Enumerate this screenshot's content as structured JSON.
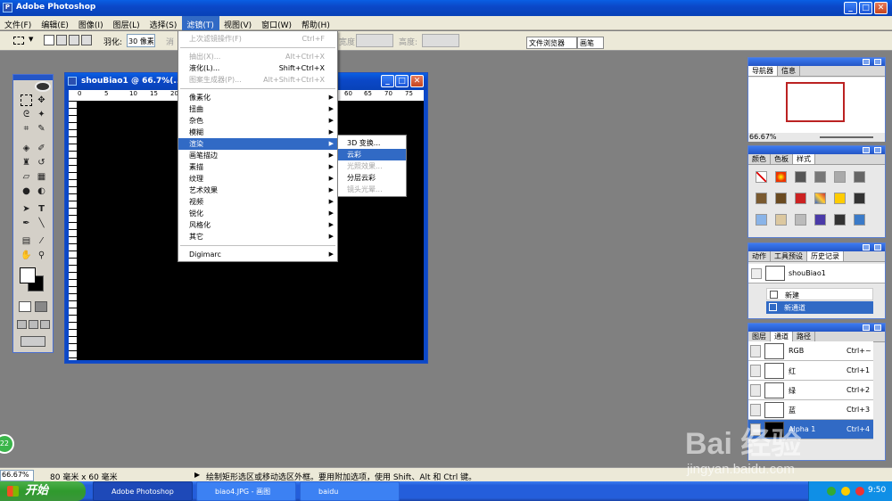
{
  "app": {
    "title": "Adobe Photoshop"
  },
  "menubar": [
    "文件(F)",
    "编辑(E)",
    "图像(I)",
    "图层(L)",
    "选择(S)",
    "滤镜(T)",
    "视图(V)",
    "窗口(W)",
    "帮助(H)"
  ],
  "options": {
    "feather_label": "羽化:",
    "feather_value": "30 像素",
    "anti_alias": "消",
    "width_label": "宽度:",
    "height_label": "高度:",
    "file_browser": "文件浏览器",
    "brushes": "画笔"
  },
  "filter_menu": {
    "last_filter": {
      "label": "上次滤镜操作(F)",
      "shortcut": "Ctrl+F"
    },
    "extract": {
      "label": "抽出(X)...",
      "shortcut": "Alt+Ctrl+X"
    },
    "liquify": {
      "label": "液化(L)...",
      "shortcut": "Shift+Ctrl+X"
    },
    "pattern": {
      "label": "图案生成器(P)...",
      "shortcut": "Alt+Shift+Ctrl+X"
    },
    "items": [
      "像素化",
      "扭曲",
      "杂色",
      "模糊",
      "渲染",
      "画笔描边",
      "素描",
      "纹理",
      "艺术效果",
      "视频",
      "锐化",
      "风格化",
      "其它"
    ],
    "digimarc": "Digimarc"
  },
  "render_submenu": [
    "3D 变换...",
    "云彩",
    "光照效果...",
    "分层云彩",
    "镜头光晕..."
  ],
  "document": {
    "title": "shouBiao1 @ 66.7%(...",
    "ruler_marks": [
      "0",
      "5",
      "10",
      "15",
      "20",
      "60",
      "65",
      "70",
      "75"
    ]
  },
  "navigator": {
    "tabs": [
      "导航器",
      "信息"
    ],
    "zoom": "66.67%"
  },
  "color_panel": {
    "tabs": [
      "颜色",
      "色板",
      "样式"
    ]
  },
  "history_panel": {
    "tabs": [
      "动作",
      "工具预设",
      "历史记录"
    ],
    "snapshot": "shouBiao1",
    "steps": [
      "新建",
      "新通道"
    ]
  },
  "channels_panel": {
    "tabs": [
      "图层",
      "通道",
      "路径"
    ],
    "channels": [
      {
        "name": "RGB",
        "key": "Ctrl+~"
      },
      {
        "name": "红",
        "key": "Ctrl+1"
      },
      {
        "name": "绿",
        "key": "Ctrl+2"
      },
      {
        "name": "蓝",
        "key": "Ctrl+3"
      },
      {
        "name": "Alpha 1",
        "key": "Ctrl+4"
      }
    ]
  },
  "status": {
    "zoom": "66.67%",
    "doc_size": "80 毫米 x 60 毫米",
    "hint": "绘制矩形选区或移动选区外框。要用附加选项，使用 Shift、Alt 和 Ctrl 键。"
  },
  "taskbar": {
    "start": "开始",
    "items": [
      "Adobe Photoshop",
      "biao4.JPG - 画图",
      "baidu"
    ],
    "clock": "9:50"
  },
  "watermark": {
    "logo": "Bai 经验",
    "url": "jingyan.baidu.com"
  },
  "side_badge": "22",
  "colors": {
    "xp_blue": "#0b48c8",
    "highlight": "#316ac5",
    "canvas": "#000000",
    "workspace": "#808080"
  }
}
